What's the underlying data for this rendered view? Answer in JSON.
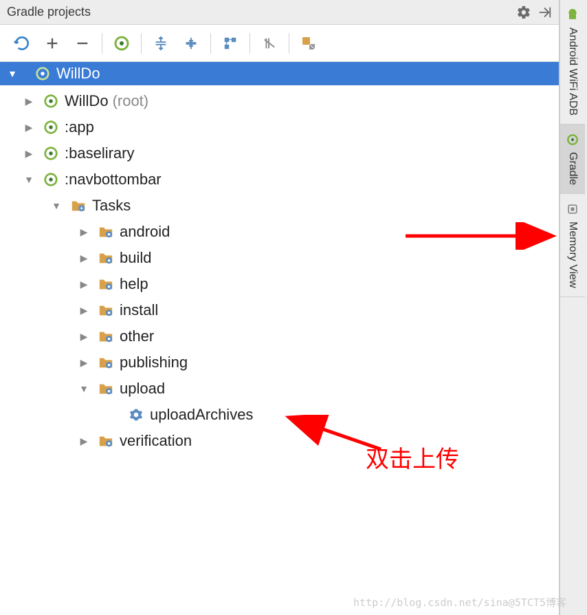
{
  "panel": {
    "title": "Gradle projects"
  },
  "root": {
    "label": "WillDo"
  },
  "tree": {
    "root_module": {
      "label": "WillDo",
      "suffix": "(root)"
    },
    "app": {
      "label": ":app"
    },
    "baselirary": {
      "label": ":baselirary"
    },
    "navbottombar": {
      "label": ":navbottombar"
    },
    "tasks": {
      "label": "Tasks"
    },
    "groups": {
      "android": "android",
      "build": "build",
      "help": "help",
      "install": "install",
      "other": "other",
      "publishing": "publishing",
      "upload": "upload",
      "verification": "verification"
    },
    "task_uploadArchives": "uploadArchives"
  },
  "sideTabs": {
    "wifi": "Android WiFi ADB",
    "gradle": "Gradle",
    "memory": "Memory View"
  },
  "annotation": {
    "text": "双击上传"
  },
  "watermark": "http://blog.csdn.net/sina@5TCT5博客"
}
